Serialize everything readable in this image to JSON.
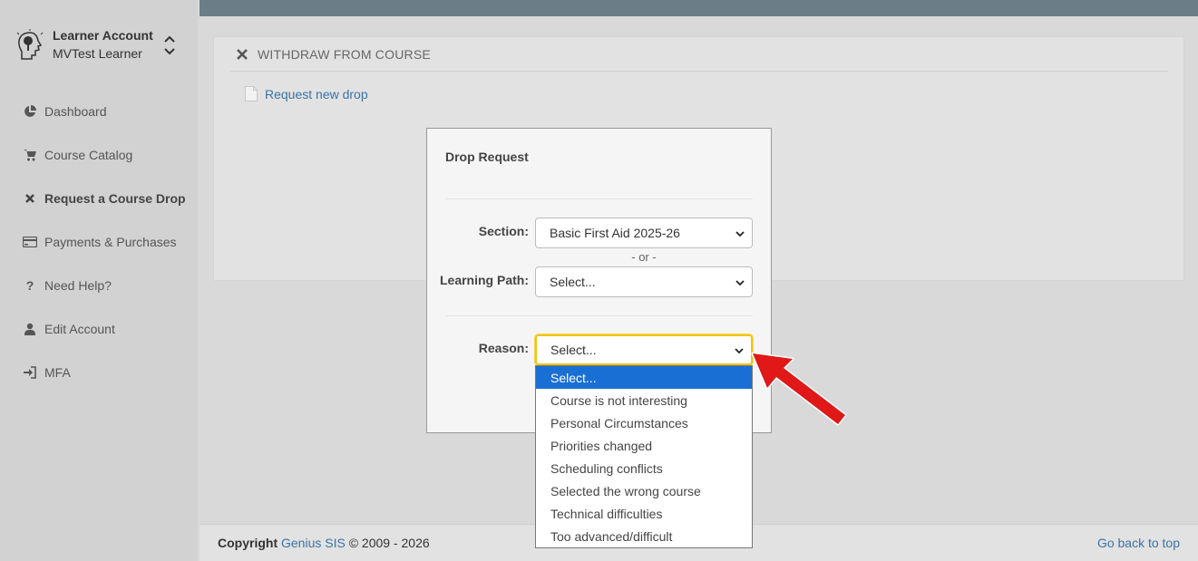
{
  "sidebar": {
    "account_title": "Learner Account",
    "account_user": "MVTest Learner",
    "items": [
      {
        "label": "Dashboard",
        "icon": "pie-chart-icon"
      },
      {
        "label": "Course Catalog",
        "icon": "cart-icon"
      },
      {
        "label": "Request a Course Drop",
        "icon": "close-icon"
      },
      {
        "label": "Payments & Purchases",
        "icon": "credit-card-icon"
      },
      {
        "label": "Need Help?",
        "icon": "question-icon"
      },
      {
        "label": "Edit Account",
        "icon": "user-icon"
      },
      {
        "label": "MFA",
        "icon": "sign-in-icon"
      }
    ]
  },
  "panel": {
    "title": "WITHDRAW FROM COURSE",
    "request_link": "Request new drop"
  },
  "modal": {
    "title": "Drop Request",
    "section_label": "Section:",
    "section_value": "Basic First Aid 2025-26",
    "or_text": "- or -",
    "learning_path_label": "Learning Path:",
    "learning_path_value": "Select...",
    "reason_label": "Reason:",
    "reason_value": "Select..."
  },
  "reason_options": [
    "Select...",
    "Course is not interesting",
    "Personal Circumstances",
    "Priorities changed",
    "Scheduling conflicts",
    "Selected the wrong course",
    "Technical difficulties",
    "Too advanced/difficult"
  ],
  "footer": {
    "copyright_label": "Copyright",
    "company": "Genius SIS",
    "years": "© 2009 - 2026",
    "back_to_top": "Go back to top"
  },
  "colors": {
    "link": "#3b73a5",
    "topbar": "#6b7e88",
    "selected_option": "#1a6fd4",
    "focus_ring": "#f0c419",
    "annotation_arrow": "#e01818"
  }
}
